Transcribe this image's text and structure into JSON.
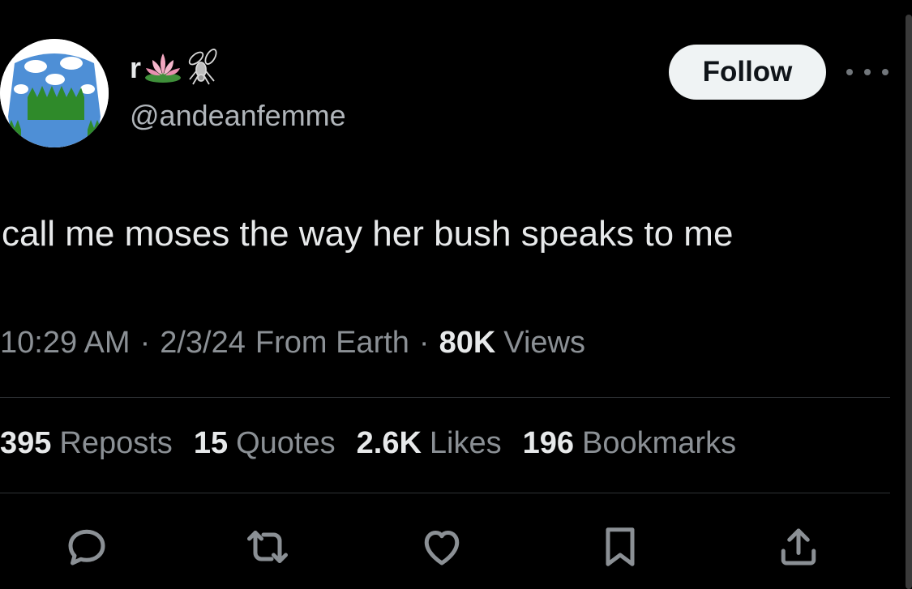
{
  "author": {
    "display_name": "r",
    "handle": "@andeanfemme",
    "avatar_icon": "sweater-clouds-avatar",
    "name_emojis": [
      "lotus-icon",
      "fly-icon"
    ]
  },
  "follow_label": "Follow",
  "tweet_text": "call me moses the way her bush speaks to me",
  "meta": {
    "time": "10:29 AM",
    "date": "2/3/24",
    "source": "From Earth",
    "views_count": "80K",
    "views_label": "Views",
    "separator": "·"
  },
  "stats": [
    {
      "num": "395",
      "label": "Reposts"
    },
    {
      "num": "15",
      "label": "Quotes"
    },
    {
      "num": "2.6K",
      "label": "Likes"
    },
    {
      "num": "196",
      "label": "Bookmarks"
    }
  ],
  "actions": [
    "reply-icon",
    "repost-icon",
    "like-icon",
    "bookmark-icon",
    "share-icon"
  ],
  "colors": {
    "background": "#000000",
    "text": "#e7e9ea",
    "muted": "#8b9095",
    "divider": "#2f3336",
    "follow_bg": "#eff3f4"
  }
}
